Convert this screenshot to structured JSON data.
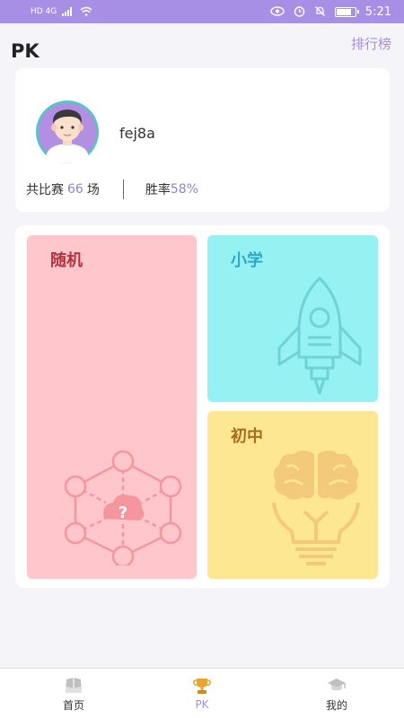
{
  "status_bar": {
    "left_text": "HD 4G",
    "time": "5:21"
  },
  "header": {
    "title": "PK",
    "ranking_link": "排行榜"
  },
  "profile": {
    "username": "fej8a",
    "matches_prefix": "共比赛",
    "matches_count": "66",
    "matches_suffix": "场",
    "win_rate_label": "胜率",
    "win_rate_value": "58%"
  },
  "modes": [
    {
      "label": "随机",
      "color": "#ffc7cc",
      "icon": "hexagon-network-question-icon"
    },
    {
      "label": "小学",
      "color": "#96f2f2",
      "icon": "rocket-icon"
    },
    {
      "label": "初中",
      "color": "#fde793",
      "icon": "brain-lightbulb-icon"
    }
  ],
  "bottom_nav": {
    "items": [
      {
        "label": "首页",
        "icon": "home-book-icon",
        "active": false
      },
      {
        "label": "PK",
        "icon": "trophy-icon",
        "active": true
      },
      {
        "label": "我的",
        "icon": "graduation-cap-icon",
        "active": false
      }
    ]
  },
  "colors": {
    "status_bar": "#a88fe6",
    "accent": "#a691d6",
    "stat_number": "#8e86c7"
  }
}
